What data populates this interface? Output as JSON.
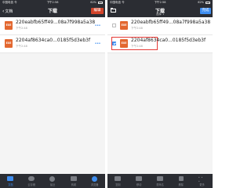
{
  "left": {
    "status": {
      "carrier": "中国电信 令",
      "time": "下午2:58",
      "battery": "62%"
    },
    "nav": {
      "back_label": "文档",
      "title": "下载",
      "edit_label": "编辑"
    },
    "files": [
      {
        "icon_text": "EXE",
        "name": "220eabfb65ff49...08a7f998a5a38",
        "meta": "下午2:48"
      },
      {
        "icon_text": "EXE",
        "name": "2204af8634ca0...0185f5d3eb3f",
        "meta": "下午2:48"
      }
    ],
    "tabs": [
      {
        "label": "文档",
        "icon": "document-icon",
        "active": true
      },
      {
        "label": "云存储",
        "icon": "cloud-icon",
        "active": false
      },
      {
        "label": "最近",
        "icon": "clock-icon",
        "active": false
      },
      {
        "label": "商城",
        "icon": "store-icon",
        "active": false
      },
      {
        "label": "浏览器",
        "icon": "browser-icon",
        "active": false
      }
    ]
  },
  "right": {
    "status": {
      "carrier": "中国电信 令",
      "time": "下午2:58",
      "battery": "62%"
    },
    "nav": {
      "title": "下载",
      "subtitle": "选择 1",
      "done_label": "完成"
    },
    "files": [
      {
        "icon_text": "EXE",
        "name": "220eabfb65ff49...08a7f998a5a38",
        "meta": "下午2:48",
        "checked": false
      },
      {
        "icon_text": "EXE",
        "name": "2204af8634ca0...0185f5d3eb3f",
        "meta": "下午2:48",
        "checked": true
      }
    ],
    "tabs": [
      {
        "label": "复制",
        "icon": "copy-icon"
      },
      {
        "label": "移动",
        "icon": "move-icon"
      },
      {
        "label": "重命名",
        "icon": "rename-icon"
      },
      {
        "label": "删除",
        "icon": "trash-icon"
      },
      {
        "label": "更多",
        "icon": "more-icon"
      }
    ]
  },
  "colors": {
    "header": "#2b2d33",
    "edit": "#d2442a",
    "accent": "#3f8ef0",
    "file_icon": "#e3672f",
    "highlight": "#e53935"
  }
}
